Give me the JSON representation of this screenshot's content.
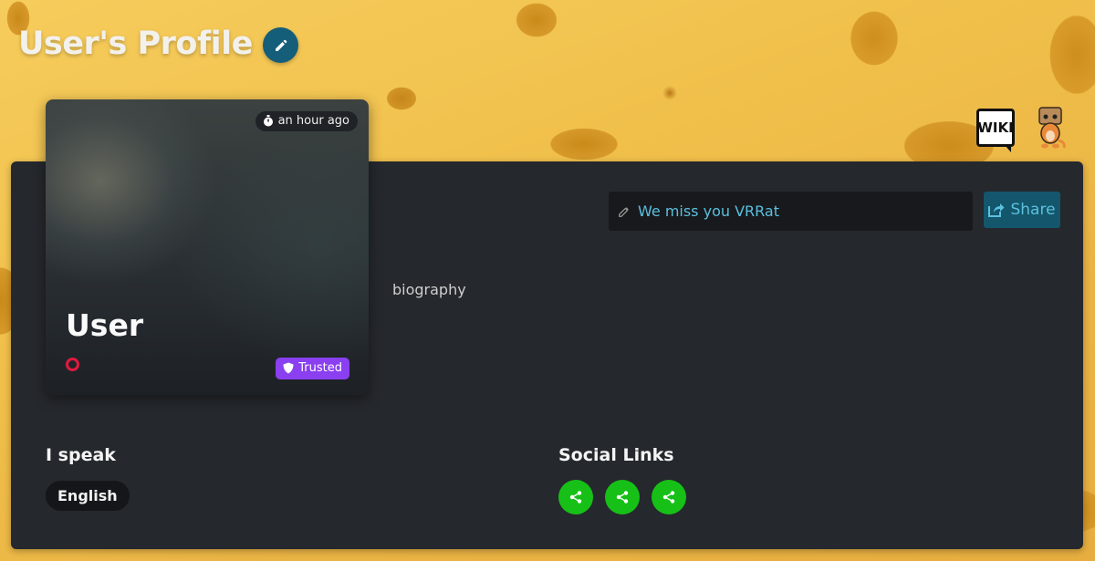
{
  "header": {
    "title": "User's Profile",
    "edit_icon": "pencil-icon"
  },
  "corner": {
    "wiki_label": "WIKI",
    "mascot_icon": "rat-mascot-icon"
  },
  "profile": {
    "last_seen": "an hour ago",
    "last_seen_icon": "stopwatch-icon",
    "name": "User",
    "status_color": "#e3193f",
    "badge": "Trusted",
    "badge_icon": "shield-icon",
    "badge_color": "#8a3ff0"
  },
  "status": {
    "text": "We miss you VRRat",
    "icon": "pencil-icon"
  },
  "share": {
    "label": "Share",
    "icon": "share-square-icon"
  },
  "bio": "biography",
  "languages": {
    "heading": "I speak",
    "items": [
      "English"
    ]
  },
  "social": {
    "heading": "Social Links",
    "links": [
      {
        "icon": "share-nodes-icon",
        "color": "#17c017"
      },
      {
        "icon": "share-nodes-icon",
        "color": "#17c017"
      },
      {
        "icon": "share-nodes-icon",
        "color": "#17c017"
      }
    ]
  }
}
